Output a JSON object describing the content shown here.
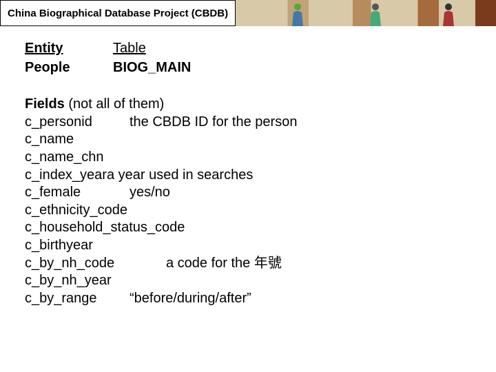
{
  "header": {
    "title": "China Biographical Database Project (CBDB)"
  },
  "entity": {
    "label": "Entity",
    "value": "People"
  },
  "table": {
    "label": "Table",
    "value": "BIOG_MAIN"
  },
  "fields": {
    "heading": "Fields",
    "note": "(not all of them)",
    "items": [
      {
        "name": "c_personid",
        "desc": "the CBDB ID for the person"
      },
      {
        "name": "c_name",
        "desc": ""
      },
      {
        "name": "c_name_chn",
        "desc": ""
      },
      {
        "name": "c_index_year",
        "desc": "a year used in searches",
        "tight": true
      },
      {
        "name": "c_female",
        "desc": "yes/no"
      },
      {
        "name": "c_ethnicity_code",
        "desc": ""
      },
      {
        "name": "c_household_status_code",
        "desc": ""
      },
      {
        "name": "c_birthyear",
        "desc": ""
      },
      {
        "name": "c_by_nh_code",
        "desc": "a code for the 年號",
        "wide": true
      },
      {
        "name": "c_by_nh_year",
        "desc": ""
      },
      {
        "name": "c_by_range",
        "desc": "“before/during/after”"
      }
    ]
  }
}
